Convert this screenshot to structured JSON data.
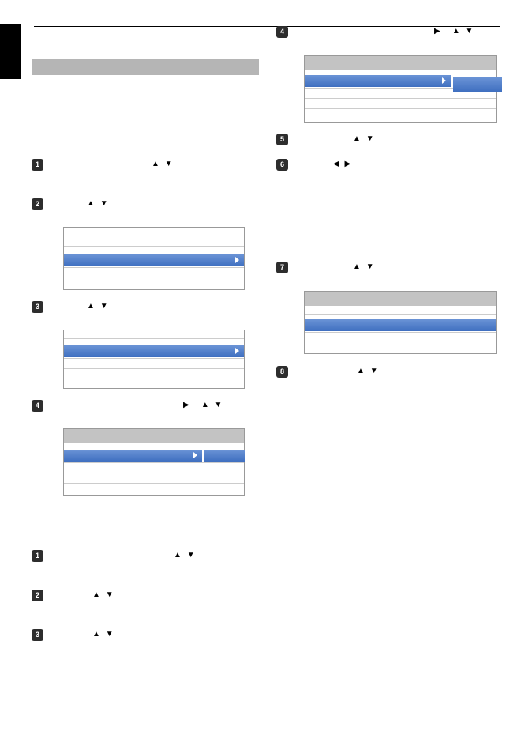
{
  "badges": {
    "one": "1",
    "two": "2",
    "three": "3",
    "four": "4",
    "five": "5",
    "six": "6",
    "seven": "7",
    "eight": "8"
  },
  "glyphs": {
    "up": "▲",
    "down": "▼",
    "left": "◀",
    "right": "▶"
  }
}
